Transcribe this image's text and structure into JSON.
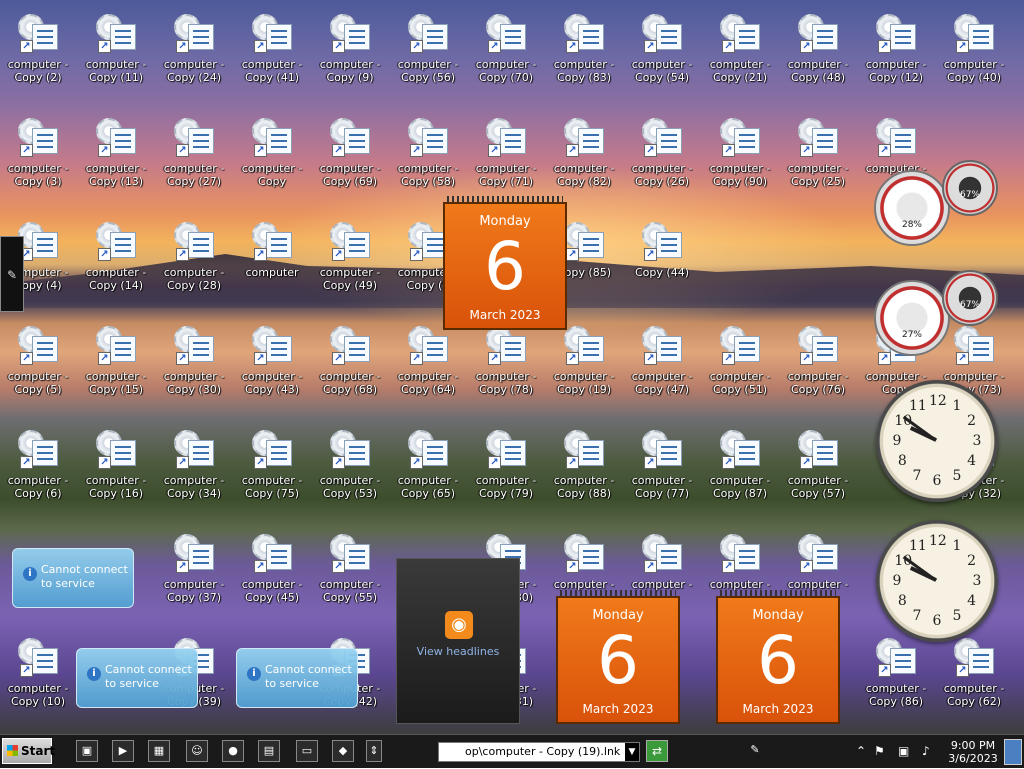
{
  "desktop": {
    "icons": [
      {
        "label": "computer - Copy (2)",
        "col": 0,
        "row": 0
      },
      {
        "label": "computer - Copy (11)",
        "col": 1,
        "row": 0
      },
      {
        "label": "computer - Copy (24)",
        "col": 2,
        "row": 0
      },
      {
        "label": "computer - Copy (41)",
        "col": 3,
        "row": 0
      },
      {
        "label": "computer - Copy (9)",
        "col": 4,
        "row": 0
      },
      {
        "label": "computer - Copy (56)",
        "col": 5,
        "row": 0
      },
      {
        "label": "computer - Copy (70)",
        "col": 6,
        "row": 0
      },
      {
        "label": "computer - Copy (83)",
        "col": 7,
        "row": 0
      },
      {
        "label": "computer - Copy (54)",
        "col": 8,
        "row": 0
      },
      {
        "label": "computer - Copy (21)",
        "col": 9,
        "row": 0
      },
      {
        "label": "computer - Copy (48)",
        "col": 10,
        "row": 0
      },
      {
        "label": "computer - Copy (12)",
        "col": 11,
        "row": 0
      },
      {
        "label": "computer - Copy (40)",
        "col": 12,
        "row": 0
      },
      {
        "label": "computer - Copy (3)",
        "col": 0,
        "row": 1
      },
      {
        "label": "computer - Copy (13)",
        "col": 1,
        "row": 1
      },
      {
        "label": "computer - Copy (27)",
        "col": 2,
        "row": 1
      },
      {
        "label": "computer - Copy",
        "col": 3,
        "row": 1
      },
      {
        "label": "computer - Copy (69)",
        "col": 4,
        "row": 1
      },
      {
        "label": "computer - Copy (58)",
        "col": 5,
        "row": 1
      },
      {
        "label": "computer - Copy (71)",
        "col": 6,
        "row": 1
      },
      {
        "label": "computer - Copy (82)",
        "col": 7,
        "row": 1
      },
      {
        "label": "computer - Copy (26)",
        "col": 8,
        "row": 1
      },
      {
        "label": "computer - Copy (90)",
        "col": 9,
        "row": 1
      },
      {
        "label": "computer - Copy (25)",
        "col": 10,
        "row": 1
      },
      {
        "label": "computer -",
        "col": 11,
        "row": 1
      },
      {
        "label": "computer - Copy (4)",
        "col": 0,
        "row": 2
      },
      {
        "label": "computer - Copy (14)",
        "col": 1,
        "row": 2
      },
      {
        "label": "computer - Copy (28)",
        "col": 2,
        "row": 2
      },
      {
        "label": "computer",
        "col": 3,
        "row": 2
      },
      {
        "label": "computer - Copy (49)",
        "col": 4,
        "row": 2
      },
      {
        "label": "computer - Copy (5",
        "col": 5,
        "row": 2
      },
      {
        "label": "Copy (85)",
        "col": 7,
        "row": 2
      },
      {
        "label": "Copy (44)",
        "col": 8,
        "row": 2
      },
      {
        "label": "computer - Copy (5)",
        "col": 0,
        "row": 3
      },
      {
        "label": "computer - Copy (15)",
        "col": 1,
        "row": 3
      },
      {
        "label": "computer - Copy (30)",
        "col": 2,
        "row": 3
      },
      {
        "label": "computer - Copy (43)",
        "col": 3,
        "row": 3
      },
      {
        "label": "computer - Copy (68)",
        "col": 4,
        "row": 3
      },
      {
        "label": "computer - Copy (64)",
        "col": 5,
        "row": 3
      },
      {
        "label": "computer - Copy (78)",
        "col": 6,
        "row": 3
      },
      {
        "label": "computer - Copy (19)",
        "col": 7,
        "row": 3
      },
      {
        "label": "computer - Copy (47)",
        "col": 8,
        "row": 3
      },
      {
        "label": "computer - Copy (51)",
        "col": 9,
        "row": 3
      },
      {
        "label": "computer - Copy (76)",
        "col": 10,
        "row": 3
      },
      {
        "label": "computer - Copy",
        "col": 11,
        "row": 3
      },
      {
        "label": "computer - Copy (73)",
        "col": 12,
        "row": 3
      },
      {
        "label": "computer - Copy (6)",
        "col": 0,
        "row": 4
      },
      {
        "label": "computer - Copy (16)",
        "col": 1,
        "row": 4
      },
      {
        "label": "computer - Copy (34)",
        "col": 2,
        "row": 4
      },
      {
        "label": "computer - Copy (75)",
        "col": 3,
        "row": 4
      },
      {
        "label": "computer - Copy (53)",
        "col": 4,
        "row": 4
      },
      {
        "label": "computer - Copy (65)",
        "col": 5,
        "row": 4
      },
      {
        "label": "computer - Copy (79)",
        "col": 6,
        "row": 4
      },
      {
        "label": "computer - Copy (88)",
        "col": 7,
        "row": 4
      },
      {
        "label": "computer - Copy (77)",
        "col": 8,
        "row": 4
      },
      {
        "label": "computer - Copy (87)",
        "col": 9,
        "row": 4
      },
      {
        "label": "computer - Copy (57)",
        "col": 10,
        "row": 4
      },
      {
        "label": "computer - Copy (32)",
        "col": 12,
        "row": 4
      },
      {
        "label": "computer - Copy (37)",
        "col": 2,
        "row": 5
      },
      {
        "label": "computer - Copy (45)",
        "col": 3,
        "row": 5
      },
      {
        "label": "computer - Copy (55)",
        "col": 4,
        "row": 5
      },
      {
        "label": "computer - Copy (80)",
        "col": 6,
        "row": 5
      },
      {
        "label": "computer -",
        "col": 7,
        "row": 5
      },
      {
        "label": "computer -",
        "col": 8,
        "row": 5
      },
      {
        "label": "computer -",
        "col": 9,
        "row": 5
      },
      {
        "label": "computer -",
        "col": 10,
        "row": 5
      },
      {
        "label": "computer - Copy (10)",
        "col": 0,
        "row": 6
      },
      {
        "label": "computer - Copy (39)",
        "col": 2,
        "row": 6
      },
      {
        "label": "computer - Copy (42)",
        "col": 4,
        "row": 6
      },
      {
        "label": "computer - Copy (31)",
        "col": 6,
        "row": 6
      },
      {
        "label": "computer - Copy (86)",
        "col": 11,
        "row": 6
      },
      {
        "label": "computer - Copy (62)",
        "col": 12,
        "row": 6
      }
    ],
    "calendars": [
      {
        "day": "Monday",
        "date": "6",
        "month": "March 2023"
      },
      {
        "day": "Monday",
        "date": "6",
        "month": "March 2023"
      },
      {
        "day": "Monday",
        "date": "6",
        "month": "March 2023"
      }
    ],
    "meters": [
      {
        "cpu": "28%",
        "mem": "67%"
      },
      {
        "cpu": "27%",
        "mem": "67%"
      }
    ],
    "clocks": [
      {
        "time_shown": "9:51"
      },
      {
        "time_shown": "9:51"
      }
    ],
    "notices": [
      {
        "text": "Cannot connect to service"
      },
      {
        "text": "Cannot connect to service"
      },
      {
        "text": "Cannot connect to service"
      }
    ],
    "rss": {
      "link_label": "View headlines"
    }
  },
  "taskbar": {
    "start_label": "Start",
    "address_value": "op\\computer - Copy (19).lnk",
    "time": "9:00 PM",
    "date": "3/6/2023"
  }
}
